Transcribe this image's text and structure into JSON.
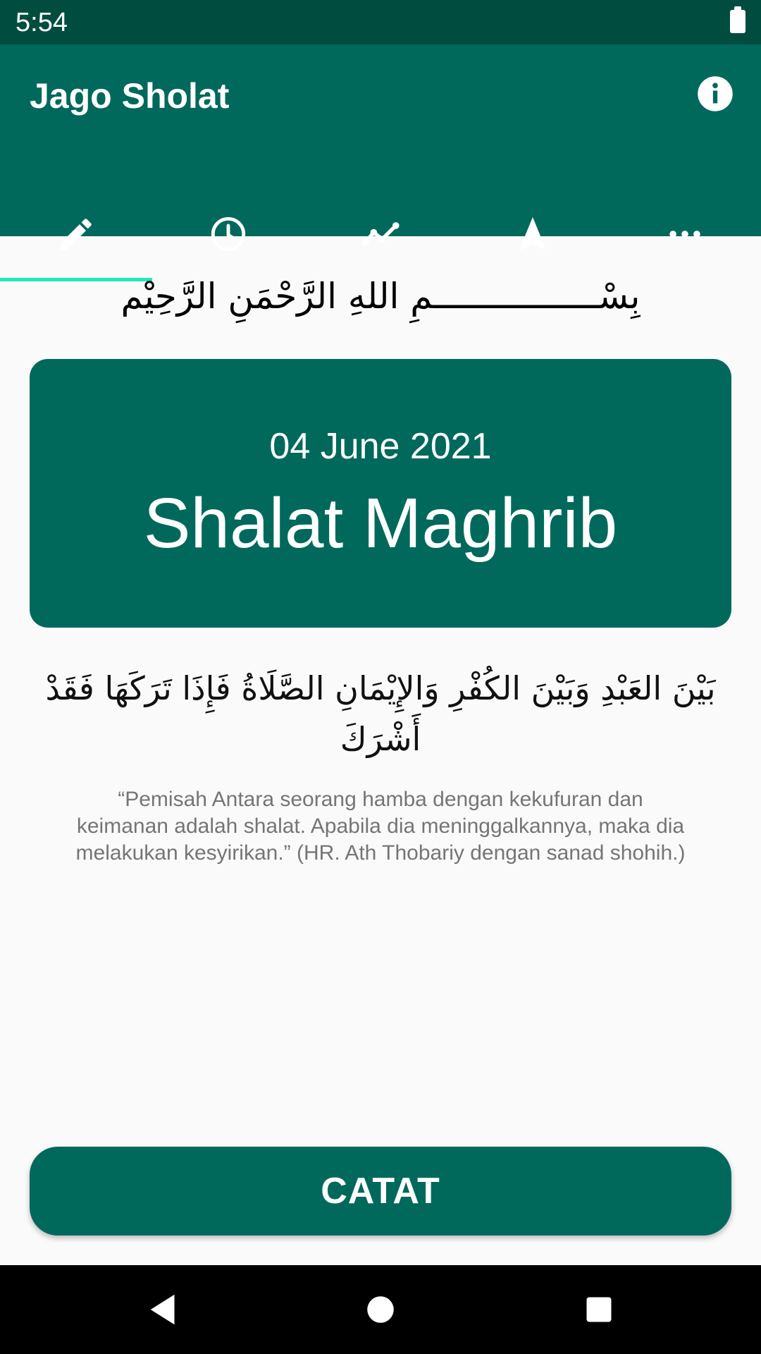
{
  "status_bar": {
    "time": "5:54"
  },
  "app_bar": {
    "title": "Jago Sholat",
    "info_icon": "info-icon"
  },
  "tabs": [
    {
      "icon": "pencil-icon",
      "selected": true
    },
    {
      "icon": "clock-icon",
      "selected": false
    },
    {
      "icon": "trend-line-icon",
      "selected": false
    },
    {
      "icon": "navigation-arrow-icon",
      "selected": false
    },
    {
      "icon": "more-horiz-icon",
      "selected": false
    }
  ],
  "bismillah": "بِسْــــــــــــــــمِ اللهِ الرَّحْمَنِ الرَّحِيْم",
  "card": {
    "date": "04 June 2021",
    "prayer": "Shalat Maghrib"
  },
  "hadith": {
    "arabic": "بَيْنَ العَبْدِ وَبَيْنَ الكُفْرِ وَالإِيْمَانِ الصَّلَاةُ فَإِذَا تَرَكَهَا فَقَدْ أَشْرَكَ",
    "translation": "“Pemisah Antara seorang hamba dengan kekufuran dan keimanan adalah shalat. Apabila dia meninggalkannya, maka dia melakukan kesyirikan.” (HR. Ath Thobariy dengan sanad shohih.)"
  },
  "actions": {
    "record_label": "CATAT"
  },
  "nav_bar": {
    "back_icon": "back-triangle-icon",
    "home_icon": "home-circle-icon",
    "recents_icon": "recents-square-icon"
  },
  "colors": {
    "status_bar": "#004d40",
    "primary": "#00695c",
    "tab_indicator": "#1de9b6",
    "background": "#fafafa",
    "translation_text": "#757575"
  }
}
